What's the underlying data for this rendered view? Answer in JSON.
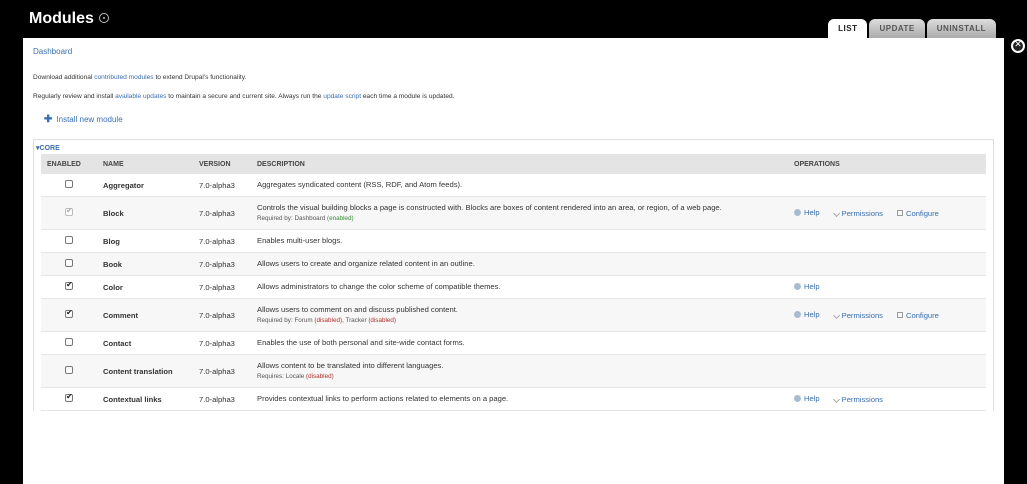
{
  "header": {
    "title": "Modules"
  },
  "tabs": [
    {
      "label": "LIST",
      "active": true
    },
    {
      "label": "UPDATE",
      "active": false
    },
    {
      "label": "UNINSTALL",
      "active": false
    }
  ],
  "breadcrumb": "Dashboard",
  "help": {
    "line1_pre": "Download additional ",
    "line1_link": "contributed modules",
    "line1_post": " to extend Drupal's functionality.",
    "line2_pre": "Regularly review and install ",
    "line2_link1": "available updates",
    "line2_mid": " to maintain a secure and current site. Always run the ",
    "line2_link2": "update script",
    "line2_post": " each time a module is updated."
  },
  "install_link": "Install new module",
  "fieldset": {
    "legend": "CORE",
    "columns": [
      "ENABLED",
      "NAME",
      "VERSION",
      "DESCRIPTION",
      "OPERATIONS"
    ]
  },
  "modules": [
    {
      "name": "Aggregator",
      "version": "7.0-alpha3",
      "description": "Aggregates syndicated content (RSS, RDF, and Atom feeds).",
      "req_label": "",
      "req_items": [],
      "enabled": false,
      "locked": false,
      "ops": []
    },
    {
      "name": "Block",
      "version": "7.0-alpha3",
      "description": "Controls the visual building blocks a page is constructed with. Blocks are boxes of content rendered into an area, or region, of a web page.",
      "req_label": "Required by: ",
      "req_items": [
        {
          "text": "Dashboard",
          "status": "(enabled)",
          "state": "enabled"
        }
      ],
      "enabled": true,
      "locked": true,
      "ops": [
        "Help",
        "Permissions",
        "Configure"
      ]
    },
    {
      "name": "Blog",
      "version": "7.0-alpha3",
      "description": "Enables multi-user blogs.",
      "req_label": "",
      "req_items": [],
      "enabled": false,
      "locked": false,
      "ops": []
    },
    {
      "name": "Book",
      "version": "7.0-alpha3",
      "description": "Allows users to create and organize related content in an outline.",
      "req_label": "",
      "req_items": [],
      "enabled": false,
      "locked": false,
      "ops": []
    },
    {
      "name": "Color",
      "version": "7.0-alpha3",
      "description": "Allows administrators to change the color scheme of compatible themes.",
      "req_label": "",
      "req_items": [],
      "enabled": true,
      "locked": false,
      "ops": [
        "Help"
      ]
    },
    {
      "name": "Comment",
      "version": "7.0-alpha3",
      "description": "Allows users to comment on and discuss published content.",
      "req_label": "Required by: ",
      "req_items": [
        {
          "text": "Forum",
          "status": "(disabled)",
          "state": "disabled"
        },
        {
          "text": "Tracker",
          "status": "(disabled)",
          "state": "disabled"
        }
      ],
      "enabled": true,
      "locked": false,
      "ops": [
        "Help",
        "Permissions",
        "Configure"
      ]
    },
    {
      "name": "Contact",
      "version": "7.0-alpha3",
      "description": "Enables the use of both personal and site-wide contact forms.",
      "req_label": "",
      "req_items": [],
      "enabled": false,
      "locked": false,
      "ops": []
    },
    {
      "name": "Content translation",
      "version": "7.0-alpha3",
      "description": "Allows content to be translated into different languages.",
      "req_label": "Requires: ",
      "req_items": [
        {
          "text": "Locale",
          "status": "(disabled)",
          "state": "disabled"
        }
      ],
      "enabled": false,
      "locked": false,
      "ops": []
    },
    {
      "name": "Contextual links",
      "version": "7.0-alpha3",
      "description": "Provides contextual links to perform actions related to elements on a page.",
      "req_label": "",
      "req_items": [],
      "enabled": true,
      "locked": false,
      "ops": [
        "Help",
        "Permissions"
      ]
    }
  ],
  "colors": {
    "link": "#3a6fb0",
    "enabled": "#3a8b3a",
    "disabled": "#b0322c"
  }
}
